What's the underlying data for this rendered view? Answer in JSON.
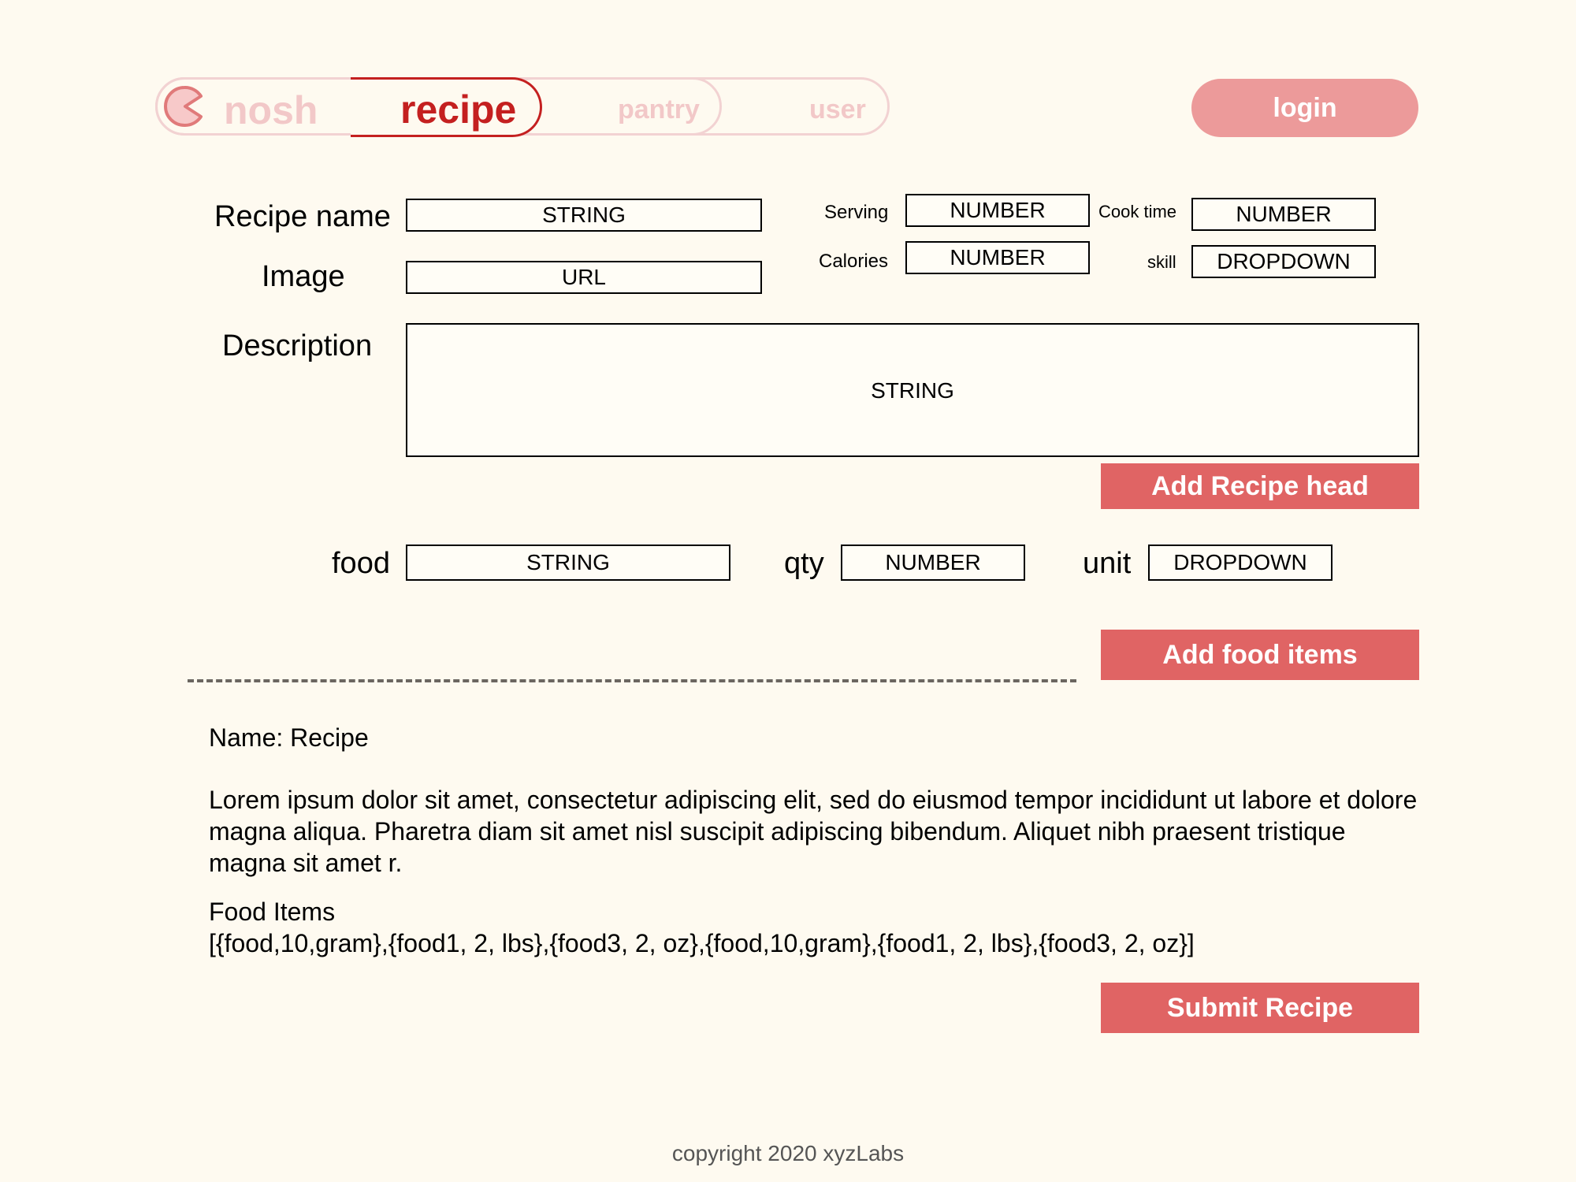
{
  "nav": {
    "logo_label": "nosh",
    "tabs": [
      {
        "label": "recipe"
      },
      {
        "label": "pantry"
      },
      {
        "label": "user"
      }
    ],
    "login_label": "login"
  },
  "form": {
    "recipe_name_label": "Recipe name",
    "recipe_name_placeholder": "STRING",
    "image_label": "Image",
    "image_placeholder": "URL",
    "serving_label": "Serving",
    "serving_placeholder": "NUMBER",
    "calories_label": "Calories",
    "calories_placeholder": "NUMBER",
    "cook_time_label": "Cook time",
    "cook_time_placeholder": "NUMBER",
    "skill_label": "skill",
    "skill_value": "DROPDOWN",
    "description_label": "Description",
    "description_placeholder": "STRING",
    "add_head_button": "Add Recipe head",
    "food_label": "food",
    "food_placeholder": "STRING",
    "qty_label": "qty",
    "qty_placeholder": "NUMBER",
    "unit_label": "unit",
    "unit_value": "DROPDOWN",
    "add_food_button": "Add food items"
  },
  "summary": {
    "name_line": "Name: Recipe",
    "description": "Lorem ipsum dolor sit amet, consectetur adipiscing elit, sed do eiusmod tempor incididunt ut labore et dolore magna aliqua. Pharetra diam sit amet nisl suscipit adipiscing bibendum. Aliquet nibh praesent tristique magna sit amet r.",
    "food_items_heading": "Food Items",
    "food_items_value": "[{food,10,gram},{food1, 2, lbs},{food3, 2, oz},{food,10,gram},{food1, 2, lbs},{food3, 2, oz}]",
    "submit_button": "Submit Recipe"
  },
  "footer": {
    "copyright": "copyright 2020 xyzLabs"
  },
  "colors": {
    "background": "#fefaf0",
    "accent": "#e06464",
    "active_tab": "#c42020",
    "inactive_tab": "#f2d2d2",
    "login": "#ec9a9a"
  }
}
